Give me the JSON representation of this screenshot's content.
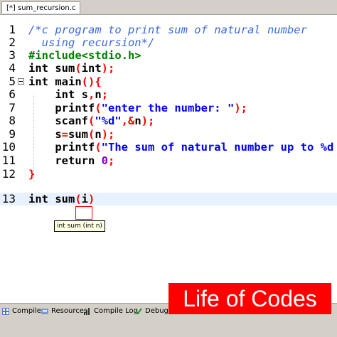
{
  "file_tab": "[*] sum_recursion.c",
  "code_lines": [
    {
      "no": "1",
      "parts": [
        {
          "t": "/*c program to print sum of natural number",
          "c": "cm"
        }
      ]
    },
    {
      "no": "2",
      "parts": [
        {
          "t": "  using recursion*/",
          "c": "cm"
        }
      ]
    },
    {
      "no": "3",
      "parts": [
        {
          "t": "#include<stdio.h>",
          "c": "pp"
        }
      ]
    },
    {
      "no": "4",
      "parts": [
        {
          "t": "int ",
          "c": "kw"
        },
        {
          "t": "sum",
          "c": "fn"
        },
        {
          "t": "(",
          "c": "sym"
        },
        {
          "t": "int",
          "c": "kw"
        },
        {
          "t": ");",
          "c": "sym"
        }
      ]
    },
    {
      "no": "5",
      "parts": [
        {
          "t": "int ",
          "c": "kw"
        },
        {
          "t": "main",
          "c": "fn"
        },
        {
          "t": "(){",
          "c": "sym"
        }
      ]
    },
    {
      "no": "6",
      "parts": [
        {
          "t": "    int ",
          "c": "kw"
        },
        {
          "t": "s",
          "c": "fn"
        },
        {
          "t": ",",
          "c": "sym"
        },
        {
          "t": "n",
          "c": "fn"
        },
        {
          "t": ";",
          "c": "sym"
        }
      ]
    },
    {
      "no": "7",
      "parts": [
        {
          "t": "    printf",
          "c": "fn"
        },
        {
          "t": "(",
          "c": "sym"
        },
        {
          "t": "\"enter the number: \"",
          "c": "str"
        },
        {
          "t": ");",
          "c": "sym"
        }
      ]
    },
    {
      "no": "8",
      "parts": [
        {
          "t": "    scanf",
          "c": "fn"
        },
        {
          "t": "(",
          "c": "sym"
        },
        {
          "t": "\"%d\"",
          "c": "str"
        },
        {
          "t": ",&",
          "c": "sym"
        },
        {
          "t": "n",
          "c": "fn"
        },
        {
          "t": ");",
          "c": "sym"
        }
      ]
    },
    {
      "no": "9",
      "parts": [
        {
          "t": "    s",
          "c": "fn"
        },
        {
          "t": "=",
          "c": "sym"
        },
        {
          "t": "sum",
          "c": "fn"
        },
        {
          "t": "(",
          "c": "sym"
        },
        {
          "t": "n",
          "c": "fn"
        },
        {
          "t": ");",
          "c": "sym"
        }
      ]
    },
    {
      "no": "10",
      "parts": [
        {
          "t": "    printf",
          "c": "fn"
        },
        {
          "t": "(",
          "c": "sym"
        },
        {
          "t": "\"The sum of natural number up to %d is",
          "c": "str"
        }
      ]
    },
    {
      "no": "11",
      "parts": [
        {
          "t": "    return ",
          "c": "kw"
        },
        {
          "t": "0",
          "c": "num"
        },
        {
          "t": ";",
          "c": "sym"
        }
      ]
    },
    {
      "no": "12",
      "parts": [
        {
          "t": "}",
          "c": "sym"
        }
      ]
    },
    {
      "no": "13",
      "parts": [
        {
          "t": "int ",
          "c": "kw"
        },
        {
          "t": "sum",
          "c": "fn"
        },
        {
          "t": "(",
          "c": "sym"
        },
        {
          "t": "i",
          "c": "fn"
        },
        {
          "t": ")",
          "c": "sym"
        }
      ]
    }
  ],
  "tooltip": "int sum (int n)",
  "bottom_tabs": [
    {
      "label": "Compiler",
      "icon": "grid-icon"
    },
    {
      "label": "Resources",
      "icon": "resources-icon"
    },
    {
      "label": "Compile Log",
      "icon": "chart-icon"
    },
    {
      "label": "Debug",
      "icon": "check-icon"
    }
  ],
  "brand": "Life of Codes",
  "colors": {
    "comment": "#3c6ad8",
    "preprocessor": "#008000",
    "string": "#0000ff",
    "number": "#7b00d6",
    "symbol": "#ff0000",
    "brand": "#ff0000"
  }
}
